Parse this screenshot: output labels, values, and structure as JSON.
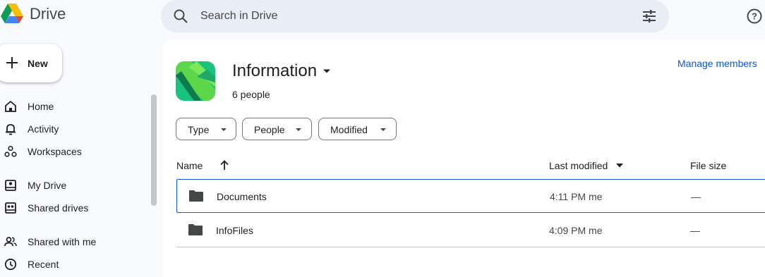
{
  "app": {
    "name": "Drive"
  },
  "search": {
    "placeholder": "Search in Drive"
  },
  "sidebar": {
    "new_label": "New",
    "items": [
      {
        "label": "Home",
        "icon": "home-icon"
      },
      {
        "label": "Activity",
        "icon": "bell-icon"
      },
      {
        "label": "Workspaces",
        "icon": "workspaces-icon"
      },
      {
        "label": "My Drive",
        "icon": "my-drive-icon"
      },
      {
        "label": "Shared drives",
        "icon": "shared-drives-icon"
      },
      {
        "label": "Shared with me",
        "icon": "people-icon"
      },
      {
        "label": "Recent",
        "icon": "clock-icon"
      }
    ]
  },
  "folder": {
    "title": "Information",
    "people": "6 people",
    "manage_label": "Manage members"
  },
  "filters": [
    "Type",
    "People",
    "Modified"
  ],
  "table": {
    "headers": {
      "name": "Name",
      "modified": "Last modified",
      "size": "File size"
    },
    "rows": [
      {
        "name": "Documents",
        "modified": "4:11 PM me",
        "size": "—"
      },
      {
        "name": "InfoFiles",
        "modified": "4:09 PM me",
        "size": "—"
      }
    ]
  },
  "colors": {
    "accent": "#0b57d0",
    "sidebar_bg": "#f8fafd",
    "search_bg": "#e9eef6"
  }
}
